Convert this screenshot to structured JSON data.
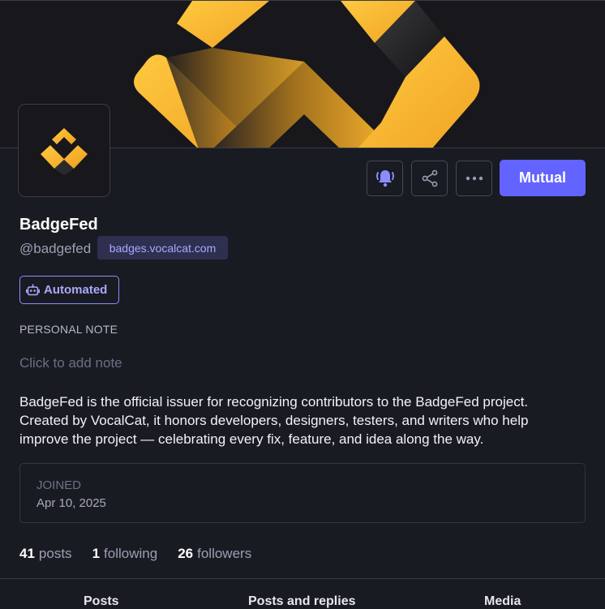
{
  "profile": {
    "display_name": "BadgeFed",
    "username": "@badgefed",
    "domain": "badges.vocalcat.com",
    "badge_label": "Automated"
  },
  "actions": {
    "notify_icon": "bell-ringing-icon",
    "share_icon": "share-icon",
    "more_icon": "ellipsis-icon",
    "follow_label": "Mutual"
  },
  "note": {
    "label": "PERSONAL NOTE",
    "placeholder": "Click to add note"
  },
  "bio": {
    "lines": [
      "BadgeFed is the official issuer for recognizing contributors to the BadgeFed project.",
      "Created by VocalCat, it honors developers, designers, testers, and writers who help",
      "improve the project — celebrating every fix, feature, and idea along the way."
    ]
  },
  "joined": {
    "label": "JOINED",
    "date": "Apr 10, 2025"
  },
  "stats": [
    {
      "count": "41",
      "label": "posts"
    },
    {
      "count": "1",
      "label": "following"
    },
    {
      "count": "26",
      "label": "followers"
    }
  ],
  "tabs": [
    "Posts",
    "Posts and replies",
    "Media"
  ],
  "colors": {
    "accent": "#6364ff",
    "logo_gold": "#f5b630",
    "background": "#191b22"
  }
}
